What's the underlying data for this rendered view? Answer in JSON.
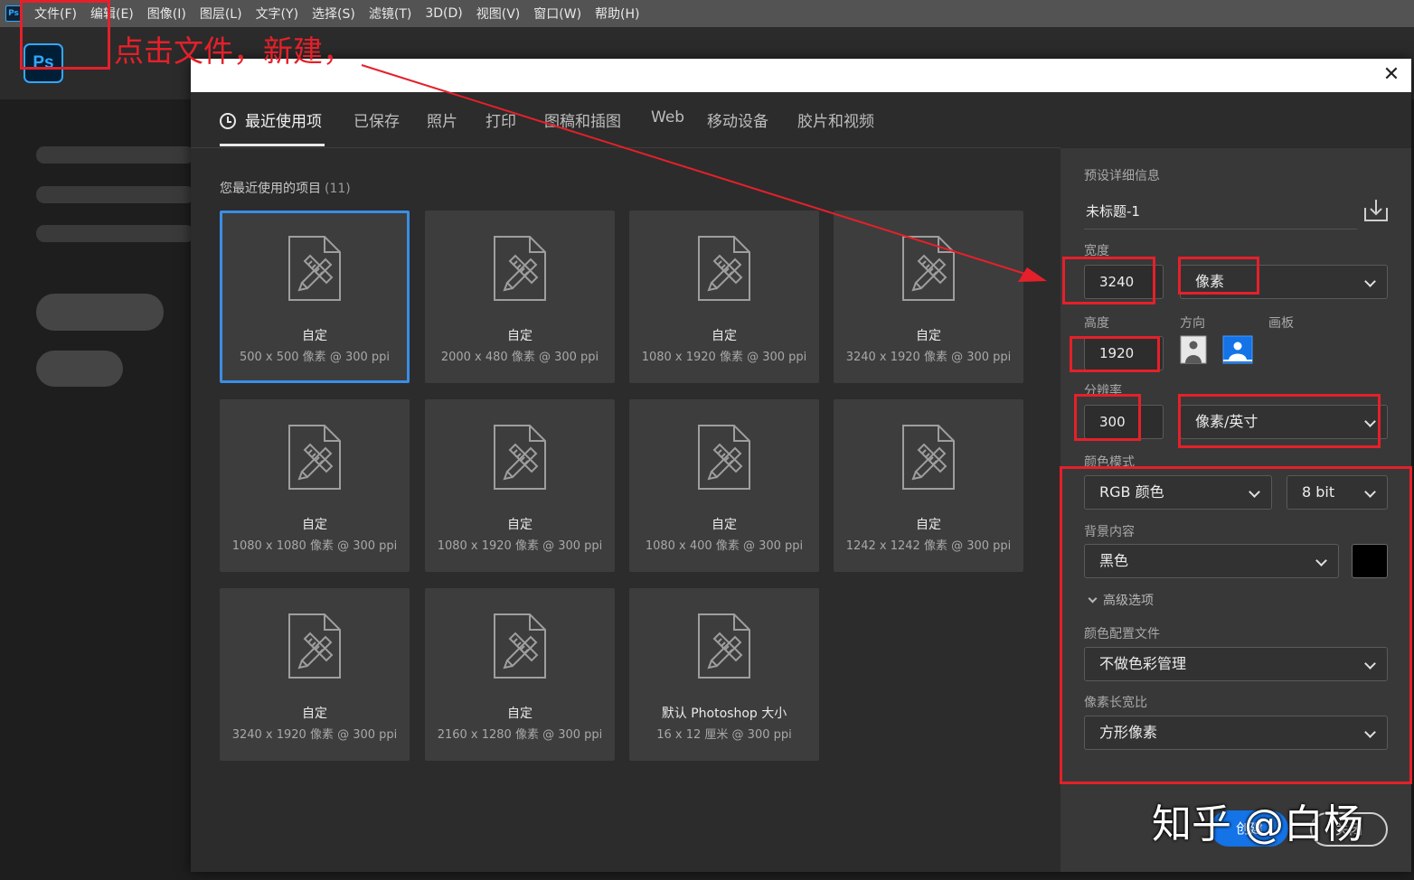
{
  "menu": {
    "logo": "Ps",
    "items": [
      "文件(F)",
      "编辑(E)",
      "图像(I)",
      "图层(L)",
      "文字(Y)",
      "选择(S)",
      "滤镜(T)",
      "3D(D)",
      "视图(V)",
      "窗口(W)",
      "帮助(H)"
    ]
  },
  "home": {
    "logo": "Ps"
  },
  "dialog": {
    "close_symbol": "✕",
    "tabs": [
      "最近使用项",
      "已保存",
      "照片",
      "打印",
      "图稿和插图",
      "Web",
      "移动设备",
      "胶片和视频"
    ],
    "recent_title": "您最近使用的项目",
    "recent_count": "(11)",
    "presets": [
      {
        "name": "自定",
        "info": "500 x 500 像素 @ 300 ppi"
      },
      {
        "name": "自定",
        "info": "2000 x 480 像素 @ 300 ppi"
      },
      {
        "name": "自定",
        "info": "1080 x 1920 像素 @ 300 ppi"
      },
      {
        "name": "自定",
        "info": "3240 x 1920 像素 @ 300 ppi"
      },
      {
        "name": "自定",
        "info": "1080 x 1080 像素 @ 300 ppi"
      },
      {
        "name": "自定",
        "info": "1080 x 1920 像素 @ 300 ppi"
      },
      {
        "name": "自定",
        "info": "1080 x 400 像素 @ 300 ppi"
      },
      {
        "name": "自定",
        "info": "1242 x 1242 像素 @ 300 ppi"
      },
      {
        "name": "自定",
        "info": "3240 x 1920 像素 @ 300 ppi"
      },
      {
        "name": "自定",
        "info": "2160 x 1280 像素 @ 300 ppi"
      },
      {
        "name": "默认 Photoshop 大小",
        "info": "16 x 12 厘米 @ 300 ppi"
      }
    ]
  },
  "details": {
    "section_title": "预设详细信息",
    "doc_name": "未标题-1",
    "width_label": "宽度",
    "width_value": "3240",
    "width_unit": "像素",
    "height_label": "高度",
    "height_value": "1920",
    "orientation_label": "方向",
    "artboard_label": "画板",
    "resolution_label": "分辨率",
    "resolution_value": "300",
    "resolution_unit": "像素/英寸",
    "color_mode_label": "颜色模式",
    "color_mode": "RGB 颜色",
    "bit_depth": "8 bit",
    "background_label": "背景内容",
    "background": "黑色",
    "background_color": "#000000",
    "advanced_label": "高级选项",
    "profile_label": "颜色配置文件",
    "profile": "不做色彩管理",
    "pixel_aspect_label": "像素长宽比",
    "pixel_aspect": "方形像素",
    "create_button": "创建",
    "close_button": "关闭"
  },
  "annotations": {
    "instruction": "点击文件，新建，",
    "watermark": "知乎 @白杨",
    "color": "#e5202a"
  }
}
